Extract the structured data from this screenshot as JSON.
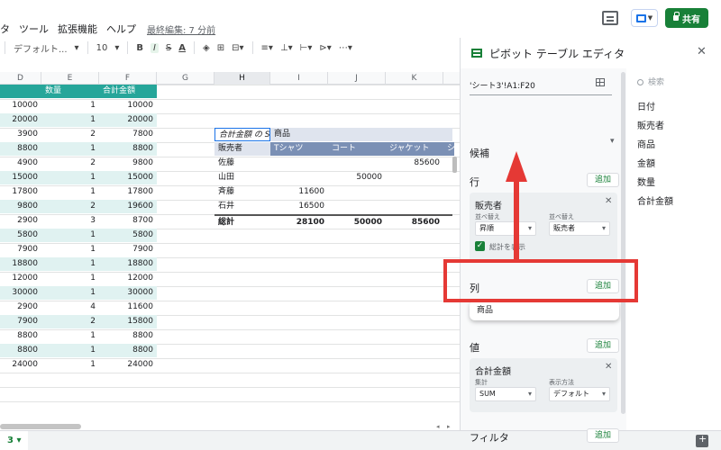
{
  "menu": {
    "items": [
      "タ",
      "ツール",
      "拡張機能",
      "ヘルプ"
    ],
    "last_edit": "最終編集: 7 分前"
  },
  "header": {
    "share_label": "共有",
    "icons": [
      "comment-icon",
      "present-icon",
      "lock-icon"
    ]
  },
  "toolbar": {
    "font": "デフォルト...",
    "font_size": "10",
    "bold": "B",
    "italic": "I",
    "strike": "S",
    "text_color": "A"
  },
  "grid": {
    "columns": [
      "D",
      "E",
      "F",
      "G",
      "H",
      "I",
      "J",
      "K"
    ],
    "data_headers": [
      "",
      "数量",
      "合計金額"
    ],
    "rows": [
      [
        "10000",
        "1",
        "10000"
      ],
      [
        "20000",
        "1",
        "20000"
      ],
      [
        "3900",
        "2",
        "7800"
      ],
      [
        "8800",
        "1",
        "8800"
      ],
      [
        "4900",
        "2",
        "9800"
      ],
      [
        "15000",
        "1",
        "15000"
      ],
      [
        "17800",
        "1",
        "17800"
      ],
      [
        "9800",
        "2",
        "19600"
      ],
      [
        "2900",
        "3",
        "8700"
      ],
      [
        "5800",
        "1",
        "5800"
      ],
      [
        "7900",
        "1",
        "7900"
      ],
      [
        "18800",
        "1",
        "18800"
      ],
      [
        "12000",
        "1",
        "12000"
      ],
      [
        "30000",
        "1",
        "30000"
      ],
      [
        "2900",
        "4",
        "11600"
      ],
      [
        "7900",
        "2",
        "15800"
      ],
      [
        "8800",
        "1",
        "8800"
      ],
      [
        "8800",
        "1",
        "8800"
      ],
      [
        "24000",
        "1",
        "24000"
      ]
    ]
  },
  "pivot": {
    "title_cell": "合計金額 の SUM",
    "col_label": "商品",
    "row_label": "販売者",
    "col_headers": [
      "Tシャツ",
      "コート",
      "ジャケット",
      "シ"
    ],
    "rows": [
      {
        "name": "佐藤",
        "values": [
          "",
          "",
          "85600"
        ]
      },
      {
        "name": "山田",
        "values": [
          "",
          "50000",
          ""
        ]
      },
      {
        "name": "斉藤",
        "values": [
          "11600",
          "",
          ""
        ]
      },
      {
        "name": "石井",
        "values": [
          "16500",
          "",
          ""
        ]
      }
    ],
    "total": {
      "name": "総計",
      "values": [
        "28100",
        "50000",
        "85600"
      ]
    }
  },
  "sheet_tab": "3 ▾",
  "editor": {
    "title": "ピボット テーブル エディタ",
    "range": "'シート3'!A1:F20",
    "suggest_label": "候補",
    "rows_label": "行",
    "add_label": "追加",
    "row_card": {
      "title": "販売者",
      "sort_label": "並べ替え",
      "sort_value": "昇順",
      "sort_by_label": "並べ替え",
      "sort_by_value": "販売者",
      "show_totals": "総計を表示"
    },
    "columns_label": "列",
    "dragging_item": "商品",
    "values_label": "値",
    "value_card": {
      "title": "合計金額",
      "summarize_label": "集計",
      "summarize_value": "SUM",
      "show_as_label": "表示方法",
      "show_as_value": "デフォルト"
    },
    "filters_label": "フィルタ",
    "search_placeholder": "検索",
    "fields": [
      "日付",
      "販売者",
      "商品",
      "金額",
      "数量",
      "合計金額"
    ]
  }
}
